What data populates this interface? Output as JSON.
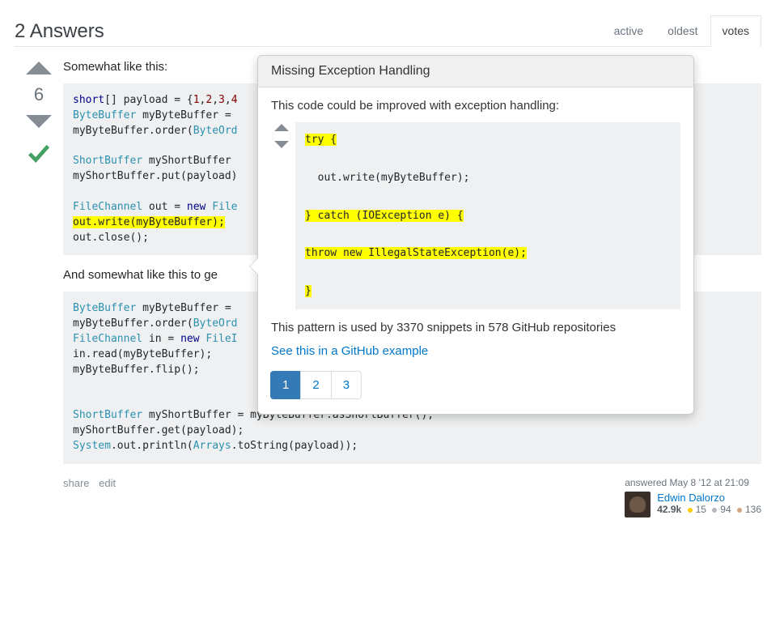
{
  "header": {
    "title": "2 Answers",
    "tabs": {
      "active": "active",
      "oldest": "oldest",
      "votes": "votes"
    }
  },
  "answer": {
    "vote_count": "6",
    "intro": "Somewhat like this:",
    "code1": {
      "l1a": "short",
      "l1b": "[] payload = {",
      "l1c": "1",
      "l1d": ",",
      "l1e": "2",
      "l1f": ",",
      "l1g": "3",
      "l1h": ",",
      "l1i": "4",
      "l2a": "ByteBuffer",
      "l2b": " myByteBuffer = ",
      "l3a": "myByteBuffer.order(",
      "l3b": "ByteOrd",
      "l4a": "ShortBuffer",
      "l4b": " myShortBuffer ",
      "l5a": "myShortBuffer.put(payload)",
      "l6a": "FileChannel",
      "l6b": " out = ",
      "l6c": "new",
      "l6d": " ",
      "l6e": "File",
      "l7a": "out.write(myByteBuffer);",
      "l8a": "out.close();"
    },
    "mid": "And somewhat like this to ge",
    "code2": {
      "l1a": "ByteBuffer",
      "l1b": " myByteBuffer = ",
      "l2a": "myByteBuffer.order(",
      "l2b": "ByteOrd",
      "l3a": "FileChannel",
      "l3b": " in = ",
      "l3c": "new",
      "l3d": " ",
      "l3e": "FileI",
      "l4a": "in.read(myByteBuffer);",
      "l5a": "myByteBuffer.flip();",
      "l6a": "ShortBuffer",
      "l6b": " myShortBuffer = myByteBuffer.asShortBuffer();",
      "l7a": "myShortBuffer.get(payload);",
      "l8a": "System",
      "l8b": ".out.println(",
      "l8c": "Arrays",
      "l8d": ".toString(payload));"
    },
    "share": "share",
    "edit": "edit",
    "answered_label": "answered May 8 '12 at 21:09",
    "user": {
      "name": "Edwin Dalorzo",
      "rep": "42.9k",
      "gold": "15",
      "silver": "94",
      "bronze": "136"
    }
  },
  "popover": {
    "title": "Missing Exception Handling",
    "desc": "This code could be improved with exception handling:",
    "snippet": {
      "l1": "try {",
      "l2": "  out.write(myByteBuffer);",
      "l3": "} catch (IOException e) {",
      "l4": "throw new IllegalStateException(e);",
      "l5": "}"
    },
    "stats": "This pattern is used by 3370 snippets in 578 GitHub repositories",
    "link": "See this in a GitHub example",
    "pages": {
      "p1": "1",
      "p2": "2",
      "p3": "3"
    }
  }
}
